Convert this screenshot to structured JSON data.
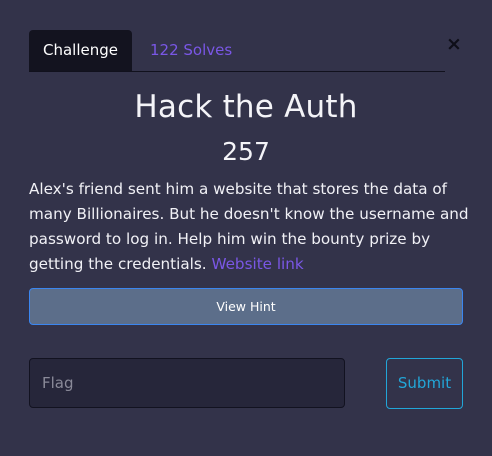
{
  "tabs": {
    "challenge_label": "Challenge",
    "solves_label": "122 Solves"
  },
  "close_icon": "×",
  "challenge": {
    "title": "Hack the Auth",
    "points": "257",
    "description": "Alex's friend sent him a website that stores the data of many Billionaires. But he doesn't know the username and password to log in. Help him win the bounty prize by getting the credentials.",
    "link_label": "Website link"
  },
  "hint": {
    "button_label": "View Hint"
  },
  "flag": {
    "placeholder": "Flag",
    "value": "",
    "submit_label": "Submit"
  },
  "colors": {
    "background": "#33334a",
    "accent": "#7a57e6",
    "submit": "#22a6d8",
    "hint_button": "#5c6e8a"
  },
  "icons": {
    "close": "close-icon"
  }
}
